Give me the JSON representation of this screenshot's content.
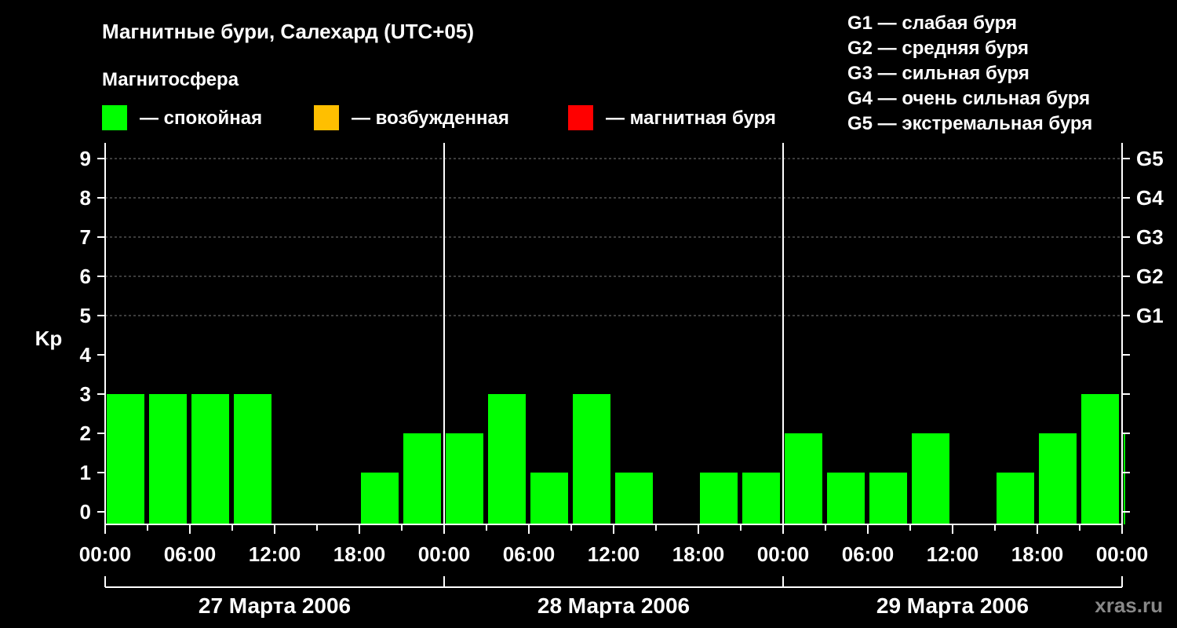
{
  "chart_data": {
    "type": "bar",
    "title": "Магнитные бури, Салехард (UTC+05)",
    "ylabel": "Kp",
    "ylim": [
      0,
      9
    ],
    "y_ticks": [
      "0",
      "1",
      "2",
      "3",
      "4",
      "5",
      "6",
      "7",
      "8",
      "9"
    ],
    "right_axis_labels": [
      {
        "value": 5,
        "label": "G1"
      },
      {
        "value": 6,
        "label": "G2"
      },
      {
        "value": 7,
        "label": "G3"
      },
      {
        "value": 8,
        "label": "G4"
      },
      {
        "value": 9,
        "label": "G5"
      }
    ],
    "x_tick_labels": [
      "00:00",
      "06:00",
      "12:00",
      "18:00",
      "00:00",
      "06:00",
      "12:00",
      "18:00",
      "00:00",
      "06:00",
      "12:00",
      "18:00",
      "00:00"
    ],
    "days": [
      "27 Марта 2006",
      "28 Марта 2006",
      "29 Марта 2006"
    ],
    "interval_hours": 3,
    "values": [
      3,
      3,
      3,
      3,
      0,
      0,
      1,
      2,
      2,
      3,
      1,
      3,
      1,
      0,
      1,
      1,
      2,
      1,
      1,
      2,
      0,
      1,
      2,
      3,
      2
    ],
    "last_bar_partial": true,
    "level_colors": {
      "quiet": "#00ff00",
      "excited": "#ffbf00",
      "storm": "#ff0000"
    },
    "grid": true,
    "legend_position": "top-left",
    "legend_title": "Магнитосфера",
    "legend": [
      {
        "key": "quiet",
        "label": "— спокойная",
        "color": "#00ff00"
      },
      {
        "key": "excited",
        "label": "— возбужденная",
        "color": "#ffbf00"
      },
      {
        "key": "storm",
        "label": "— магнитная буря",
        "color": "#ff0000"
      }
    ],
    "storm_scale": [
      "G1 — слабая буря",
      "G2 — средняя буря",
      "G3 — сильная буря",
      "G4 — очень сильная буря",
      "G5 — экстремальная буря"
    ],
    "watermark": "xras.ru"
  }
}
